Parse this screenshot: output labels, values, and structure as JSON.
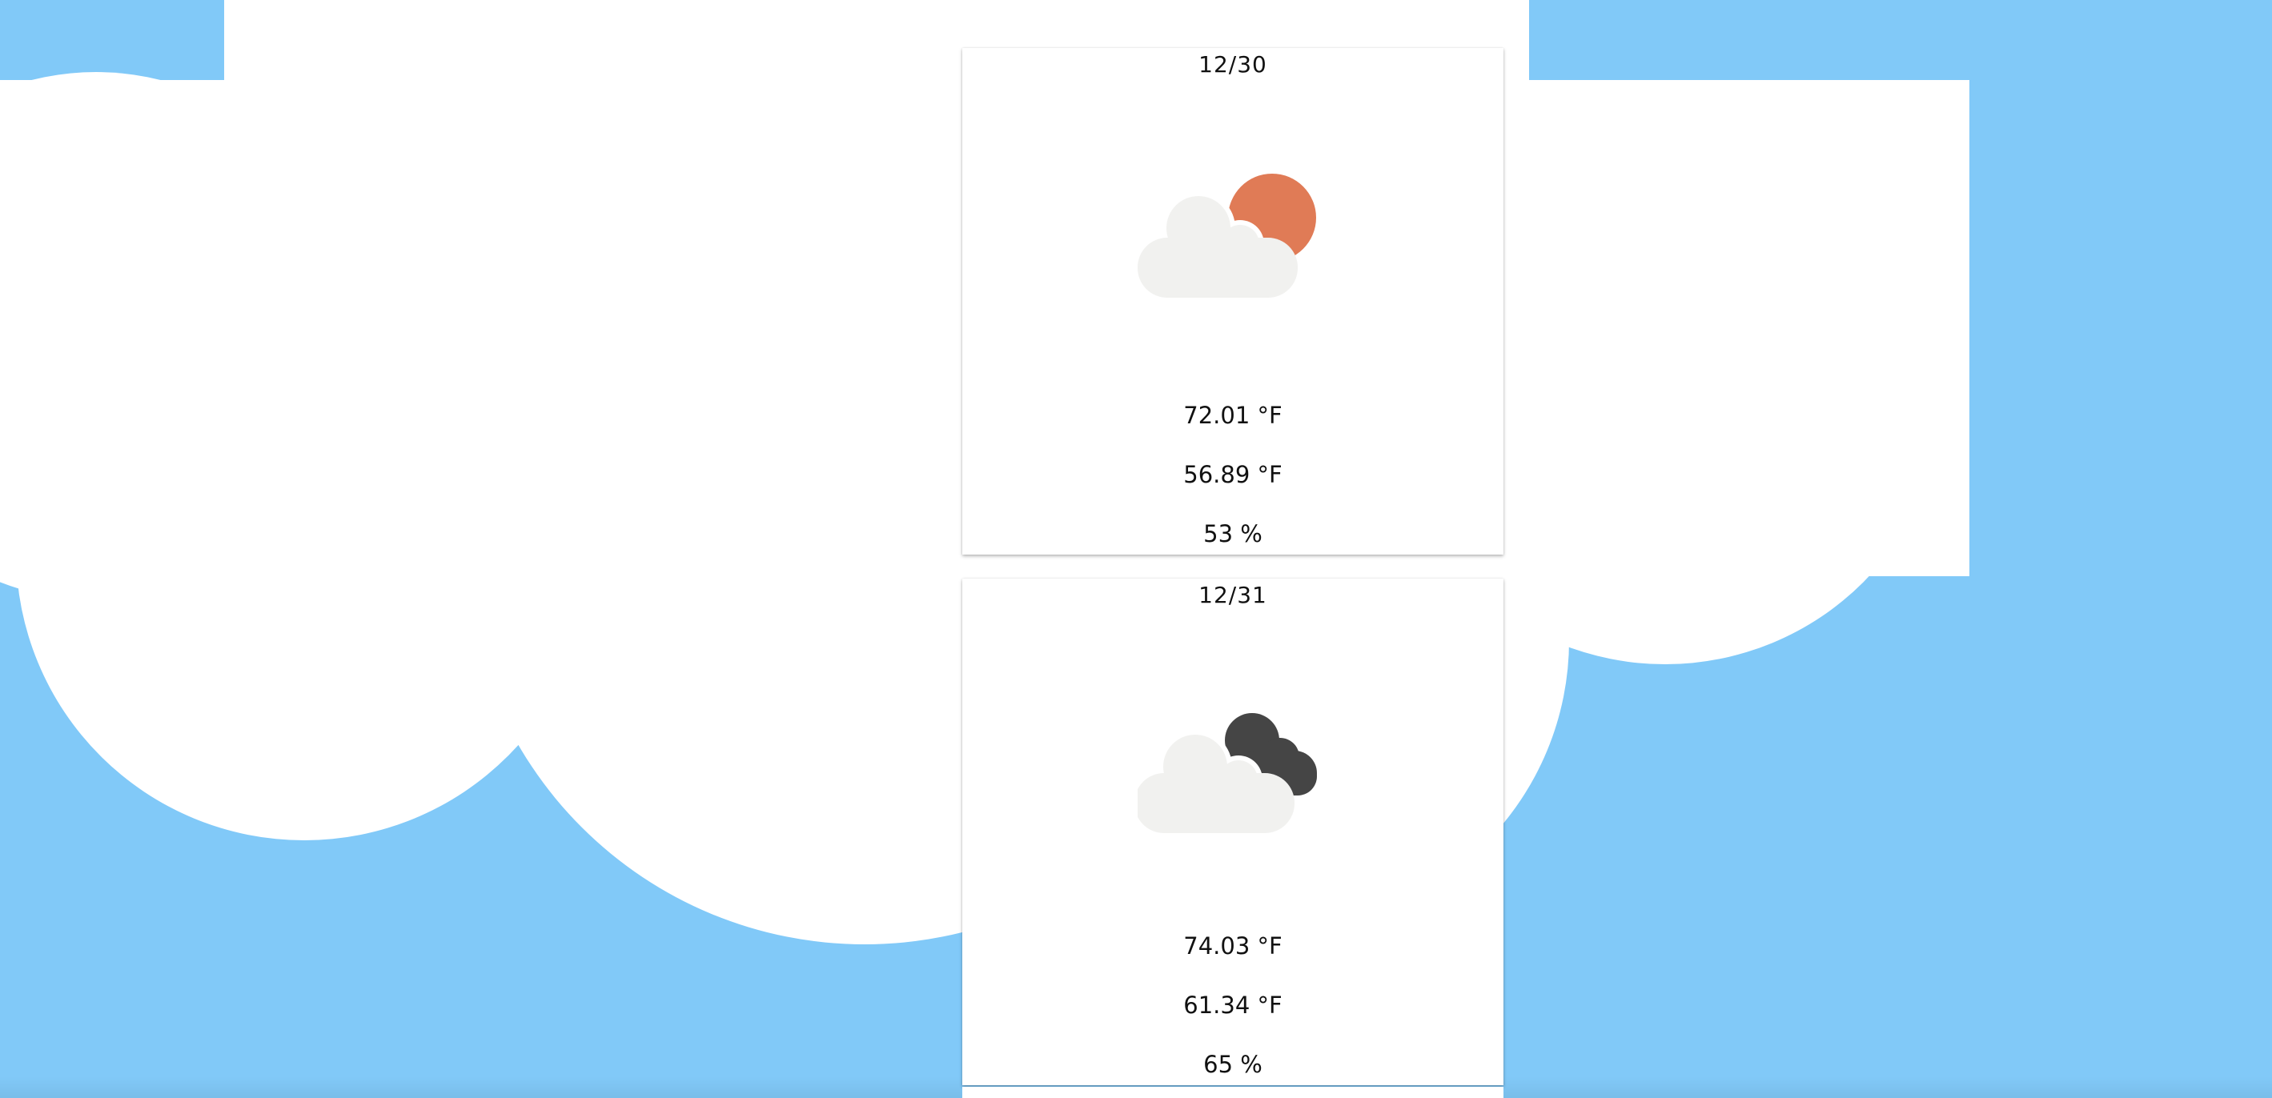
{
  "colors": {
    "sky": "#81c9f8",
    "cloud": "#ffffff",
    "card": "#ffffff",
    "sun": "#e07b56",
    "icon_cloud": "#f1f1ef",
    "dark_cloud": "#454545"
  },
  "forecast": [
    {
      "date": "12/30",
      "icon": "partly-cloudy-day-icon",
      "high": "72.01 °F",
      "low": "56.89 °F",
      "humidity": "53 %"
    },
    {
      "date": "12/31",
      "icon": "cloudy-icon",
      "high": "74.03 °F",
      "low": "61.34 °F",
      "humidity": "65 %"
    }
  ]
}
